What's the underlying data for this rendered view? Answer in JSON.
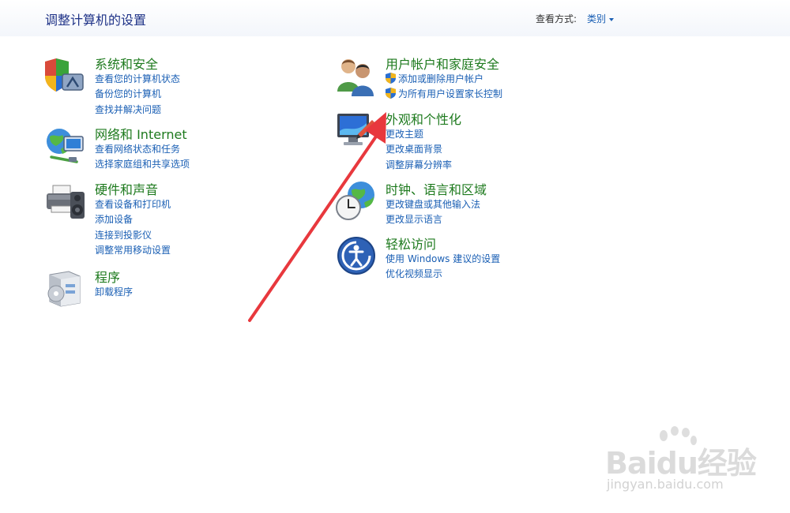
{
  "header": {
    "title": "调整计算机的设置",
    "view_by_label": "查看方式:",
    "view_by_value": "类别"
  },
  "categories_left": [
    {
      "title": "系统和安全",
      "icon": "shield-computer-icon",
      "links": [
        "查看您的计算机状态",
        "备份您的计算机",
        "查找并解决问题"
      ]
    },
    {
      "title": "网络和 Internet",
      "icon": "globe-network-icon",
      "links": [
        "查看网络状态和任务",
        "选择家庭组和共享选项"
      ]
    },
    {
      "title": "硬件和声音",
      "icon": "printer-speaker-icon",
      "links": [
        "查看设备和打印机",
        "添加设备",
        "连接到投影仪",
        "调整常用移动设置"
      ]
    },
    {
      "title": "程序",
      "icon": "programs-box-icon",
      "links": [
        "卸载程序"
      ]
    }
  ],
  "categories_right": [
    {
      "title": "用户帐户和家庭安全",
      "icon": "users-icon",
      "links": [
        "添加或删除用户帐户",
        "为所有用户设置家长控制"
      ]
    },
    {
      "title": "外观和个性化",
      "icon": "monitor-personalize-icon",
      "links": [
        "更改主题",
        "更改桌面背景",
        "调整屏幕分辨率"
      ]
    },
    {
      "title": "时钟、语言和区域",
      "icon": "clock-globe-icon",
      "links": [
        "更改键盘或其他输入法",
        "更改显示语言"
      ]
    },
    {
      "title": "轻松访问",
      "icon": "ease-of-access-icon",
      "links": [
        "使用 Windows 建议的设置",
        "优化视频显示"
      ]
    }
  ],
  "watermark": {
    "text": "Baidu经验",
    "sub": "jingyan.baidu.com"
  },
  "colors": {
    "title_blue": "#1e3287",
    "link_blue": "#1a5fb4",
    "category_green": "#1e7a1e",
    "arrow_red": "#e8383d"
  }
}
